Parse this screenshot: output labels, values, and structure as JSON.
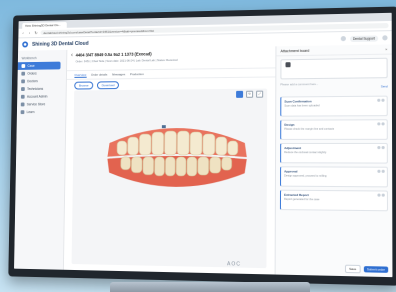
{
  "browser": {
    "tab_title": "View Shining3D Dental Clo...",
    "url": "dentalcloud.shining3d.com/caseDetail?orderId=3451&version=4&tab=preview&from=list"
  },
  "app": {
    "title": "Shining 3D Dental Cloud",
    "user": "Dental Support"
  },
  "sidebar": {
    "group_label": "Workbench",
    "items": [
      {
        "label": "Case"
      },
      {
        "label": "Orders"
      },
      {
        "label": "Doctors"
      },
      {
        "label": "Technicians"
      },
      {
        "label": "Account Admin"
      },
      {
        "label": "Service Store"
      },
      {
        "label": "Learn"
      }
    ]
  },
  "case": {
    "name": "4404 3/4T 8949 0.5a 9a2 1 1373 (Exocad)",
    "meta": "Order: 3451  |  Chair Side  |  Scan date: 2021-06-24  |  Lab: Dental Lab  |  Status: Received"
  },
  "tabs": [
    {
      "label": "Overview"
    },
    {
      "label": "Order details"
    },
    {
      "label": "Messages"
    },
    {
      "label": "Production"
    }
  ],
  "toolbar": {
    "left_pill": "Browse",
    "right_pill": "Download"
  },
  "panel": {
    "title": "Attachment board",
    "note": "Please add a comment here...",
    "send_label": "Send",
    "messages": [
      {
        "title": "Scan Confirmation",
        "text": "Scan data has been uploaded"
      },
      {
        "title": "Design",
        "text": "Please check the margin line and contacts"
      },
      {
        "title": "Adjustment",
        "text": "Reduce the occlusal contact slightly"
      },
      {
        "title": "Approval",
        "text": "Design approved, proceed to milling"
      },
      {
        "title": "Extracted Report",
        "text": "Report generated for the case"
      }
    ],
    "buttons": {
      "ghost": "Save",
      "primary": "Submit order"
    }
  },
  "monitor_brand": "AOC"
}
